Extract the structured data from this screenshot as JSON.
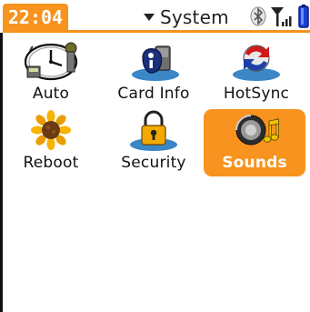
{
  "status_bar": {
    "time": "22:04",
    "category": "System",
    "icons": [
      "bluetooth-icon",
      "signal-strength-icon",
      "battery-icon"
    ]
  },
  "colors": {
    "accent": "#f7931e",
    "text": "#111111",
    "background": "#ffffff"
  },
  "apps": [
    {
      "label": "Auto",
      "icon": "clock-icon",
      "selected": false
    },
    {
      "label": "Card Info",
      "icon": "card-info-icon",
      "selected": false
    },
    {
      "label": "HotSync",
      "icon": "hotsync-icon",
      "selected": false
    },
    {
      "label": "Reboot",
      "icon": "sunflower-icon",
      "selected": false
    },
    {
      "label": "Security",
      "icon": "padlock-icon",
      "selected": false
    },
    {
      "label": "Sounds",
      "icon": "speaker-icon",
      "selected": true
    }
  ]
}
